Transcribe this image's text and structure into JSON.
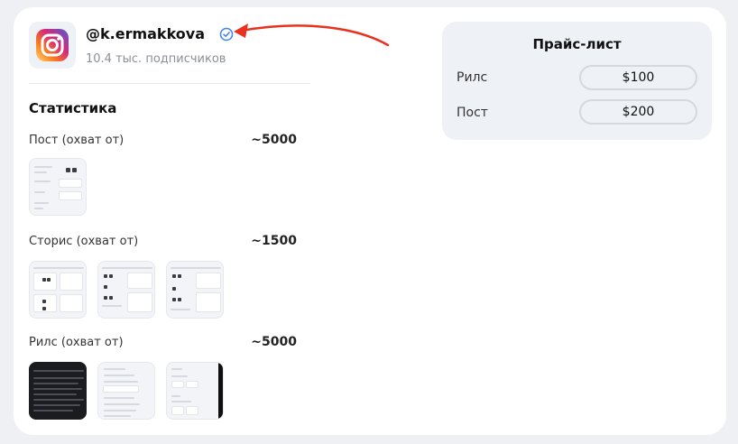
{
  "profile": {
    "handle": "@k.ermakkova",
    "followers": "10.4 тыс. подписчиков",
    "platform_icon": "instagram-icon",
    "verified_icon": "verified-check-icon",
    "verified_color": "#3b82f6",
    "arrow_color": "#e8321f"
  },
  "stats": {
    "title": "Статистика",
    "rows": [
      {
        "label": "Пост (охват от)",
        "value": "~5000",
        "thumbnails": 1
      },
      {
        "label": "Сторис (охват от)",
        "value": "~1500",
        "thumbnails": 3
      },
      {
        "label": "Рилс (охват от)",
        "value": "~5000",
        "thumbnails": 3
      }
    ]
  },
  "pricelist": {
    "title": "Прайс-лист",
    "items": [
      {
        "label": "Рилс",
        "price": "$100"
      },
      {
        "label": "Пост",
        "price": "$200"
      }
    ]
  }
}
